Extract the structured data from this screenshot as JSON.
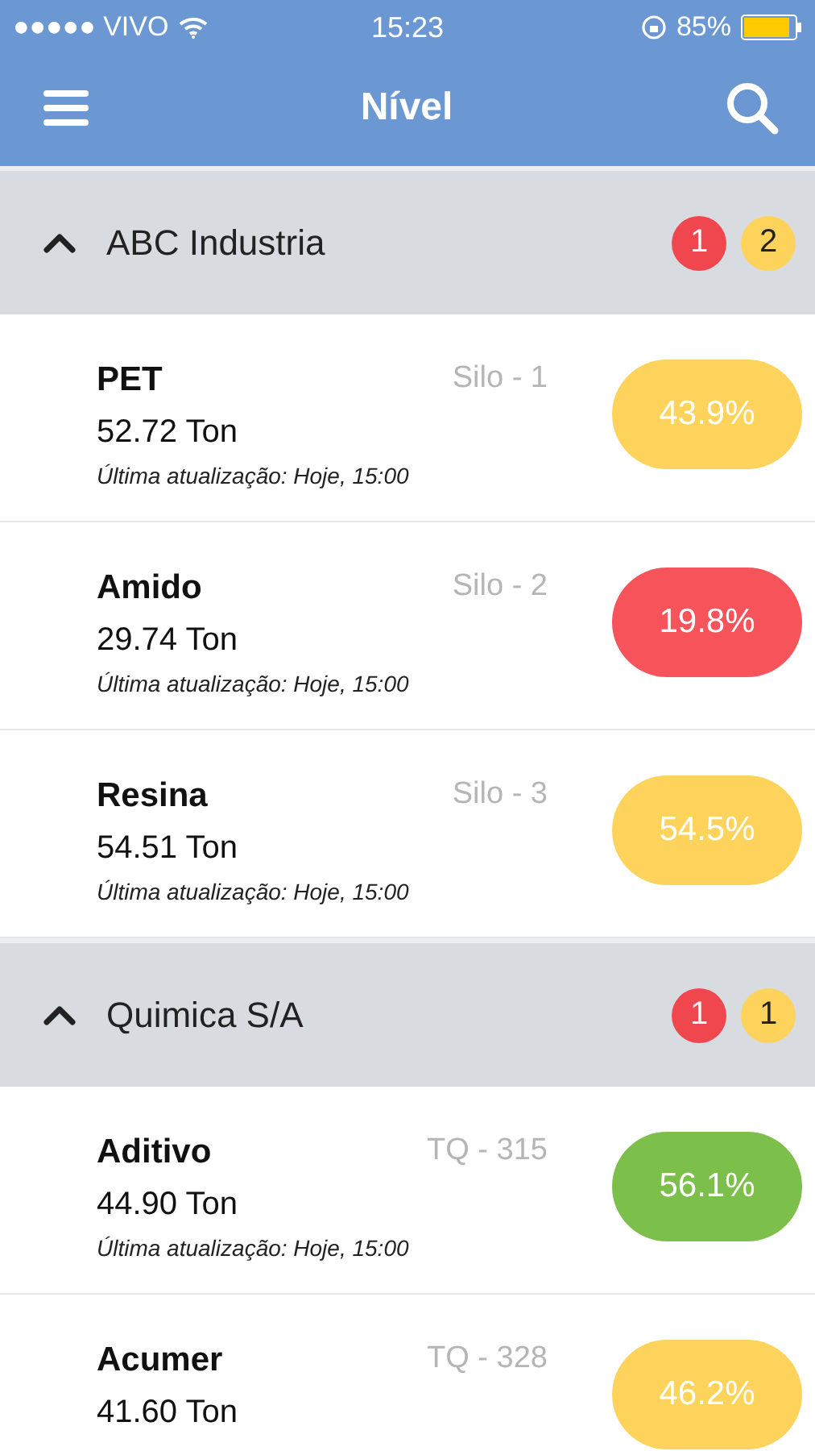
{
  "status_bar": {
    "carrier": "●●●●● VIVO",
    "time": "15:23",
    "battery": "85%"
  },
  "nav": {
    "title": "Nível"
  },
  "groups": [
    {
      "name": "ABC Industria",
      "expanded": true,
      "badges": [
        {
          "count": "1",
          "color": "#f0474e"
        },
        {
          "count": "2",
          "color": "#fdd35c"
        }
      ],
      "items": [
        {
          "name": "PET",
          "amount": "52.72 Ton",
          "location": "Silo - 1",
          "updated": "Última atualização: Hoje, 15:00",
          "percent": "43.9%",
          "color": "#fdd35c"
        },
        {
          "name": "Amido",
          "amount": "29.74 Ton",
          "location": "Silo - 2",
          "updated": "Última atualização: Hoje, 15:00",
          "percent": "19.8%",
          "color": "#f6535a"
        },
        {
          "name": "Resina",
          "amount": "54.51 Ton",
          "location": "Silo - 3",
          "updated": "Última atualização: Hoje, 15:00",
          "percent": "54.5%",
          "color": "#fdd35c"
        }
      ]
    },
    {
      "name": "Quimica S/A",
      "expanded": true,
      "badges": [
        {
          "count": "1",
          "color": "#f0474e"
        },
        {
          "count": "1",
          "color": "#fdd35c"
        }
      ],
      "items": [
        {
          "name": "Aditivo",
          "amount": "44.90 Ton",
          "location": "TQ - 315",
          "updated": "Última atualização: Hoje, 15:00",
          "percent": "56.1%",
          "color": "#7cc04b"
        },
        {
          "name": "Acumer",
          "amount": "41.60 Ton",
          "location": "TQ - 328",
          "percent": "46.2%",
          "color": "#fdd35c"
        }
      ]
    }
  ]
}
